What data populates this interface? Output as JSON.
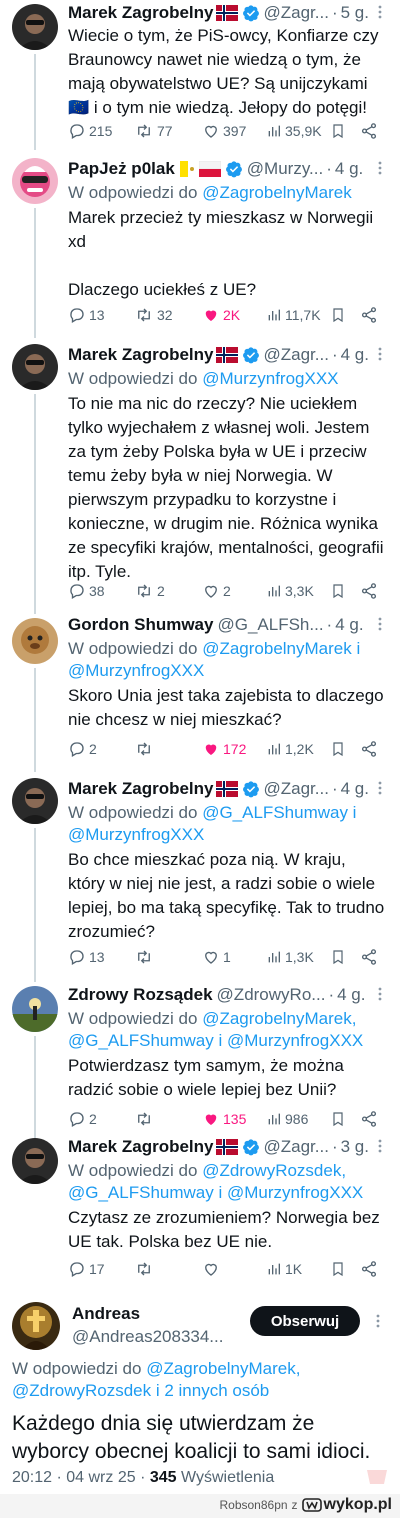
{
  "tweets": [
    {
      "name": "Marek Zagrobelny",
      "handle": "@Zagr...",
      "time": "5 g.",
      "reply_to_prefix": "",
      "reply_to_users": "",
      "text": "Wiecie o tym, że PiS-owcy, Konfiarze czy Braunowcy nawet nie wiedzą o tym, że mają obywatelstwo UE? Są unijczykami 🇪🇺 i o tym nie wiedzą. Jełopy do potęgi!",
      "replies": "215",
      "reposts": "77",
      "likes": "397",
      "views": "35,9K",
      "liked": false
    },
    {
      "name": "PapJeż p0lak",
      "handle": "@Murzy...",
      "time": "4 g.",
      "reply_to_prefix": "W odpowiedzi do",
      "reply_to_users": "@ZagrobelnyMarek",
      "text": "Marek przecież ty mieszkasz w Norwegii xd\n\nDlaczego uciekłeś z UE?",
      "replies": "13",
      "reposts": "32",
      "likes": "2K",
      "views": "11,7K",
      "liked": true
    },
    {
      "name": "Marek Zagrobelny",
      "handle": "@Zagr...",
      "time": "4 g.",
      "reply_to_prefix": "W odpowiedzi do",
      "reply_to_users": "@MurzynfrogXXX",
      "text": "To nie ma nic do rzeczy? Nie uciekłem tylko wyjechałem z własnej woli. Jestem za tym żeby Polska była w UE i przeciw temu żeby była w niej Norwegia. W pierwszym przypadku to korzystne i konieczne, w drugim nie. Różnica wynika ze specyfiki krajów, mentalności, geografii itp. Tyle.",
      "replies": "38",
      "reposts": "2",
      "likes": "2",
      "views": "3,3K",
      "liked": false
    },
    {
      "name": "Gordon Shumway",
      "handle": "@G_ALFSh...",
      "time": "4 g.",
      "reply_to_prefix": "W odpowiedzi do",
      "reply_to_users": "@ZagrobelnyMarek i @MurzynfrogXXX",
      "text": "Skoro Unia jest taka zajebista to dlaczego nie chcesz w niej mieszkać?",
      "replies": "2",
      "reposts": "",
      "likes": "172",
      "views": "1,2K",
      "liked": true
    },
    {
      "name": "Marek Zagrobelny",
      "handle": "@Zagr...",
      "time": "4 g.",
      "reply_to_prefix": "W odpowiedzi do",
      "reply_to_users": "@G_ALFShumway i @MurzynfrogXXX",
      "text": "Bo chce mieszkać poza nią. W kraju, który w niej nie jest, a radzi sobie o wiele lepiej, bo ma taką specyfikę. Tak to trudno zrozumieć?",
      "replies": "13",
      "reposts": "",
      "likes": "1",
      "views": "1,3K",
      "liked": false
    },
    {
      "name": "Zdrowy Rozsądek",
      "handle": "@ZdrowyRo...",
      "time": "4 g.",
      "reply_to_prefix": "W odpowiedzi do",
      "reply_to_users": "@ZagrobelnyMarek, @G_ALFShumway i @MurzynfrogXXX",
      "text": "Potwierdzasz tym samym, że można radzić sobie o wiele lepiej bez Unii?",
      "replies": "2",
      "reposts": "",
      "likes": "135",
      "views": "986",
      "liked": true
    },
    {
      "name": "Marek Zagrobelny",
      "handle": "@Zagr...",
      "time": "3 g.",
      "reply_to_prefix": "W odpowiedzi do",
      "reply_to_users": "@ZdrowyRozsdek, @G_ALFShumway i @MurzynfrogXXX",
      "text": "Czytasz ze zrozumieniem? Norwegia bez UE tak. Polska bez UE nie.",
      "replies": "17",
      "reposts": "",
      "likes": "",
      "views": "1K",
      "liked": false
    }
  ],
  "main_tweet": {
    "name": "Andreas",
    "handle": "@Andreas208334...",
    "follow_label": "Obserwuj",
    "reply_to_prefix": "W odpowiedzi do",
    "reply_to_users_line1": "@ZagrobelnyMarek,",
    "reply_to_users_line2": "@ZdrowyRozsdek i 2 innych osób",
    "text": "Każdego dnia się utwierdzam że wyborcy obecnej koalicji to sami idioci.",
    "timestamp": "20:12 · 04 wrz 25 · ",
    "views_count": "345",
    "views_label": " Wyświetlenia"
  },
  "watermark": {
    "author": "Robson86pn",
    "connector": "z",
    "site": "wykop.pl"
  },
  "colors": {
    "accent": "#1d9bf0",
    "like": "#f91880",
    "muted": "#536471"
  }
}
